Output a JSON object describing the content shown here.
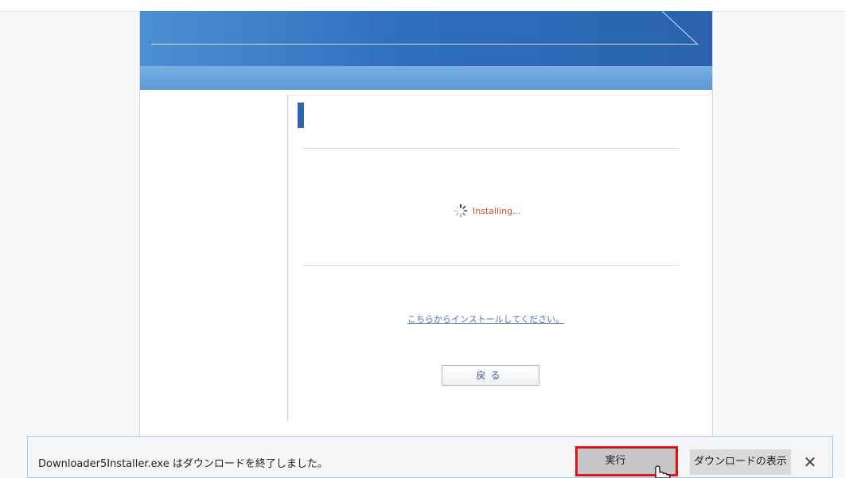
{
  "installer_page": {
    "status_text": "Installing...",
    "install_link_text": "こちらからインストールしてください。",
    "back_button_label": "戻る"
  },
  "download_bar": {
    "message": "Downloader5Installer.exe はダウンロードを終了しました。",
    "run_button_label": "実行",
    "view_downloads_label": "ダウンロードの表示",
    "close_symbol": "✕"
  },
  "icons": {
    "spinner": "loading-spinner-icon",
    "cursor": "hand-pointer-icon",
    "close": "close-icon"
  },
  "colors": {
    "banner_blue": "#2f6fbf",
    "subbar_blue": "#5a98d8",
    "status_red": "#d44a2c",
    "link_blue": "#4a73b5",
    "highlight_red": "#e2141a"
  }
}
